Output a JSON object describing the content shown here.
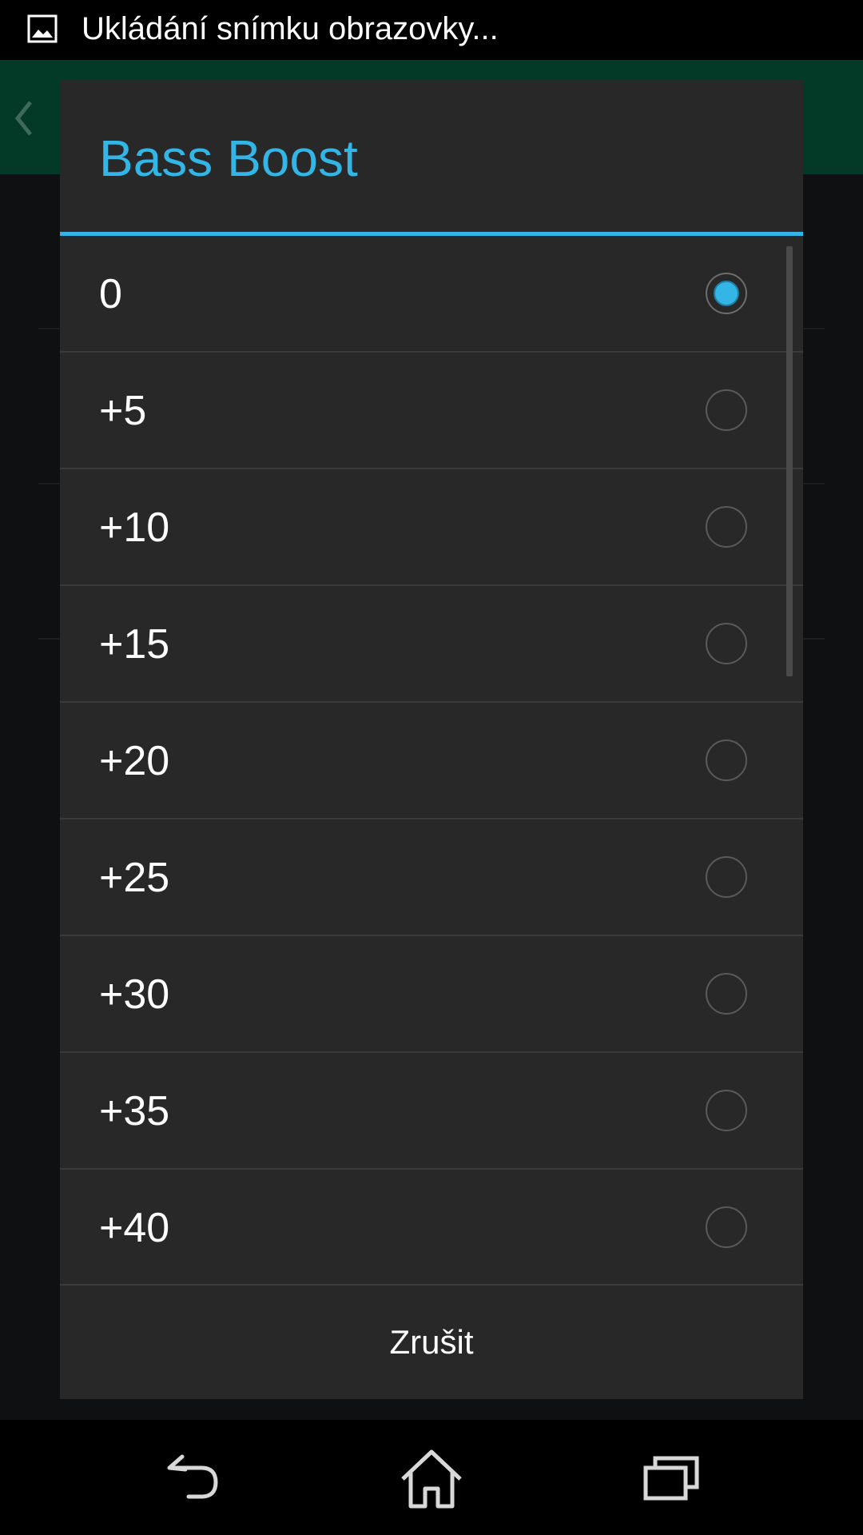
{
  "status_bar": {
    "notification_icon": "image-icon",
    "text": "Ukládání snímku obrazovky..."
  },
  "dialog": {
    "title": "Bass Boost",
    "options": [
      {
        "label": "0",
        "checked": true
      },
      {
        "label": "+5",
        "checked": false
      },
      {
        "label": "+10",
        "checked": false
      },
      {
        "label": "+15",
        "checked": false
      },
      {
        "label": "+20",
        "checked": false
      },
      {
        "label": "+25",
        "checked": false
      },
      {
        "label": "+30",
        "checked": false
      },
      {
        "label": "+35",
        "checked": false
      },
      {
        "label": "+40",
        "checked": false
      }
    ],
    "cancel_label": "Zrušit"
  },
  "nav_bar": {
    "icons": [
      "back-icon",
      "home-icon",
      "recent-apps-icon"
    ]
  },
  "colors": {
    "accent": "#33b5e5",
    "dialog_background": "#282828",
    "action_bar": "#023a27"
  }
}
